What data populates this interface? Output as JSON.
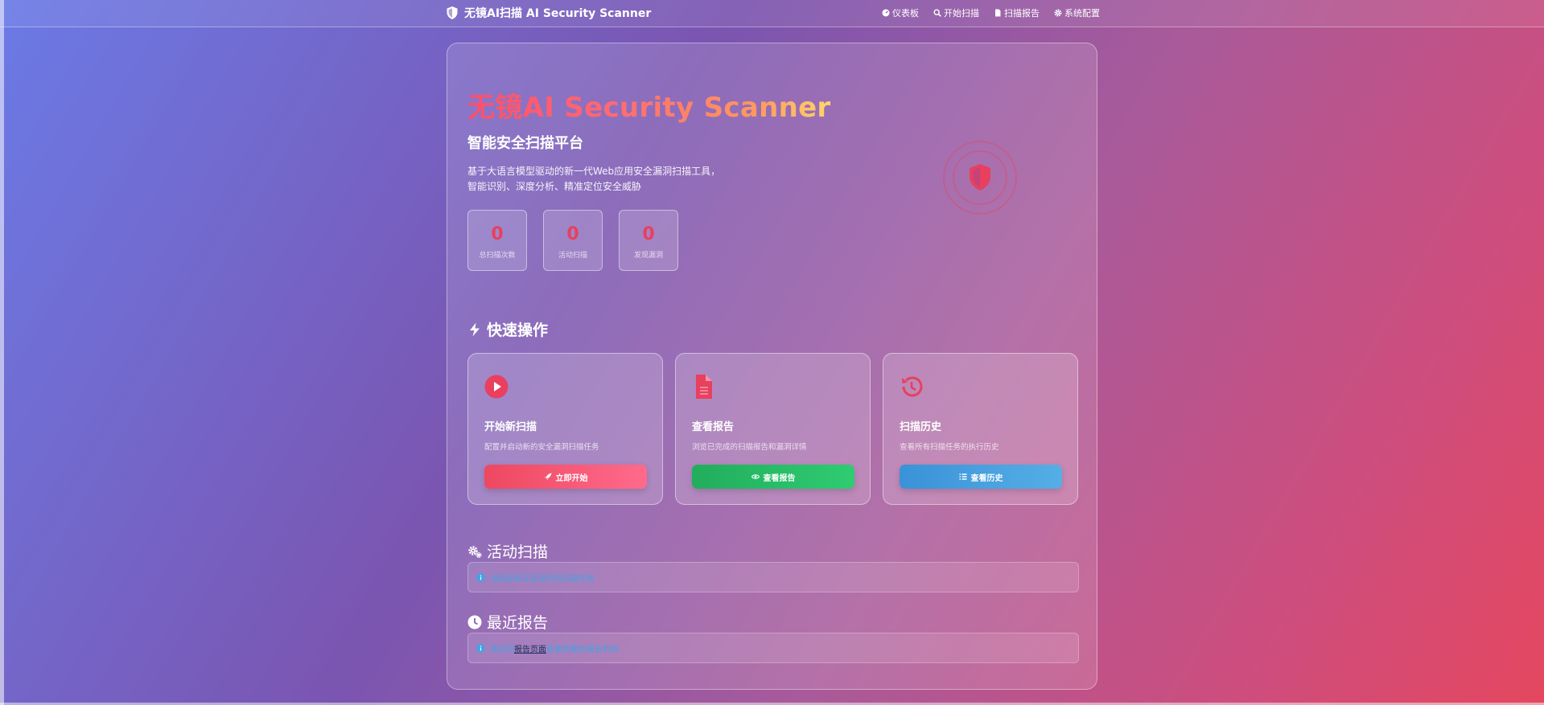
{
  "nav": {
    "brand": "无镜AI扫描 AI Security Scanner",
    "links": [
      {
        "label": "仪表板",
        "icon": "dashboard-icon"
      },
      {
        "label": "开始扫描",
        "icon": "search-icon"
      },
      {
        "label": "扫描报告",
        "icon": "file-icon"
      },
      {
        "label": "系统配置",
        "icon": "gear-icon"
      }
    ]
  },
  "hero": {
    "title": "无镜AI Security Scanner",
    "subtitle": "智能安全扫描平台",
    "desc_line1": "基于大语言模型驱动的新一代Web应用安全漏洞扫描工具，",
    "desc_line2": "智能识别、深度分析、精准定位安全威胁",
    "stats": [
      {
        "value": "0",
        "label": "总扫描次数"
      },
      {
        "value": "0",
        "label": "活动扫描"
      },
      {
        "value": "0",
        "label": "发现漏洞"
      }
    ]
  },
  "quick_actions": {
    "title": "快速操作",
    "cards": [
      {
        "title": "开始新扫描",
        "desc": "配置并启动新的安全漏洞扫描任务",
        "button": "立即开始",
        "icon": "play-circle-icon",
        "button_icon": "rocket-icon"
      },
      {
        "title": "查看报告",
        "desc": "浏览已完成的扫描报告和漏洞详情",
        "button": "查看报告",
        "icon": "file-text-icon",
        "button_icon": "eye-icon"
      },
      {
        "title": "扫描历史",
        "desc": "查看所有扫描任务的执行历史",
        "button": "查看历史",
        "icon": "history-icon",
        "button_icon": "list-icon"
      }
    ]
  },
  "active_scans": {
    "title": "活动扫描",
    "message": "当前没有正在进行的扫描任务"
  },
  "recent_reports": {
    "title": "最近报告",
    "msg_prefix": "请访问",
    "link": "报告页面",
    "msg_suffix": "查看完整的报告列表"
  },
  "colors": {
    "accent": "#e8405e",
    "green": "#2ecc71",
    "blue": "#3a92d8",
    "info": "#3fa4e6"
  }
}
